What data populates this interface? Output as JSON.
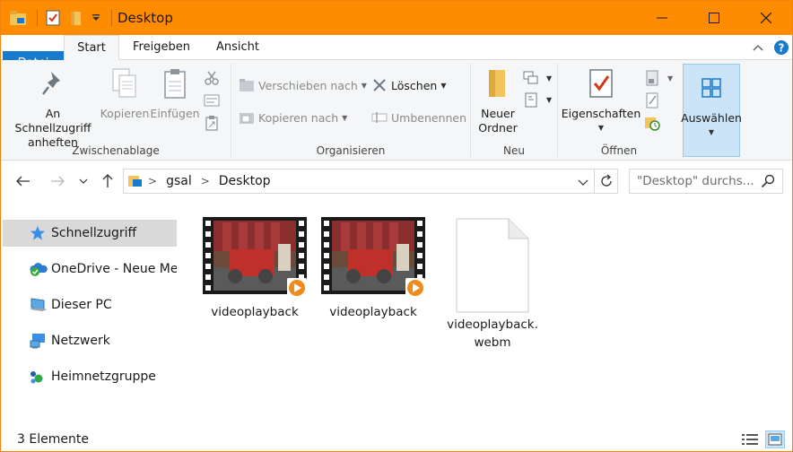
{
  "window": {
    "title": "Desktop",
    "accent_color": "#ff8c00"
  },
  "ribbon_tabs": {
    "file": "Datei",
    "start": "Start",
    "share": "Freigeben",
    "view": "Ansicht",
    "file_tab_color": "#1979ca"
  },
  "ribbon": {
    "clipboard": {
      "label": "Zwischenablage",
      "pin_line1": "An Schnellzugriff",
      "pin_line2": "anheften",
      "copy": "Kopieren",
      "paste": "Einfügen"
    },
    "organize": {
      "label": "Organisieren",
      "move_to": "Verschieben nach",
      "copy_to": "Kopieren nach",
      "delete": "Löschen",
      "rename": "Umbenennen"
    },
    "new": {
      "label": "Neu",
      "new_folder_line1": "Neuer",
      "new_folder_line2": "Ordner"
    },
    "open": {
      "label": "Öffnen",
      "properties": "Eigenschaften"
    },
    "select": {
      "label": "Auswählen"
    }
  },
  "address": {
    "crumbs": [
      "gsal",
      "Desktop"
    ],
    "search_placeholder": "\"Desktop\" durchs..."
  },
  "nav_pane": {
    "items": [
      {
        "label": "Schnellzugriff",
        "icon": "star-icon",
        "selected": true
      },
      {
        "label": "OneDrive - Neue Med",
        "icon": "onedrive-icon",
        "selected": false
      },
      {
        "label": "Dieser PC",
        "icon": "computer-icon",
        "selected": false
      },
      {
        "label": "Netzwerk",
        "icon": "network-icon",
        "selected": false
      },
      {
        "label": "Heimnetzgruppe",
        "icon": "homegroup-icon",
        "selected": false
      }
    ]
  },
  "files": [
    {
      "name": "videoplayback",
      "type": "video"
    },
    {
      "name": "videoplayback",
      "type": "video"
    },
    {
      "name": "videoplayback.webm",
      "type": "blank"
    }
  ],
  "status": {
    "count_text": "3 Elemente"
  }
}
